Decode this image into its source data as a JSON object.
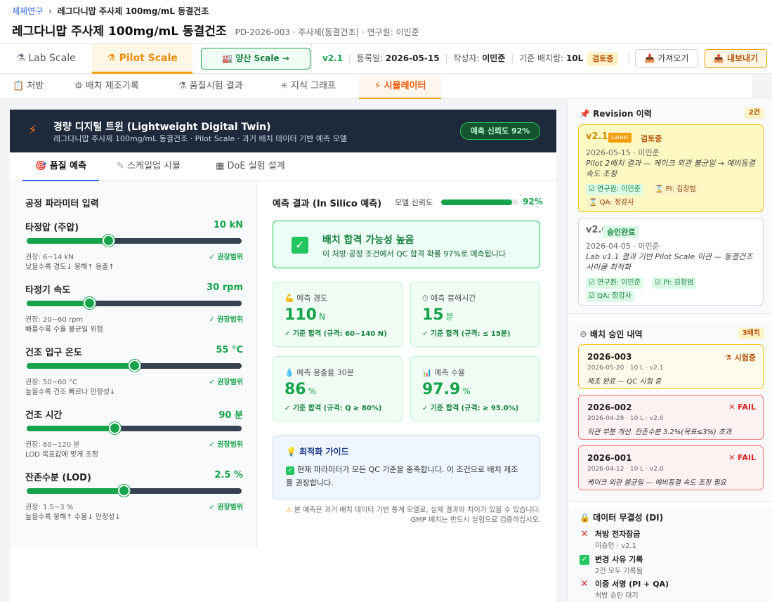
{
  "breadcrumb": {
    "root": "제제연구",
    "sep": "›",
    "current": "레그다니맙 주사제 100mg/mL 동결건조"
  },
  "header": {
    "title": "레그다니맙 주사제 100mg/mL 동결건조",
    "meta": "PD-2026-003 · 주사제(동결건조) · 연구원: 이민준"
  },
  "scale": {
    "lab": "Lab Scale",
    "pilot": "Pilot Scale",
    "mass": "양산 Scale →"
  },
  "info": {
    "version": "v2.1",
    "reg_label": "등록일:",
    "reg": "2026-05-15",
    "author_label": "작성자:",
    "author": "이민준",
    "batch_label": "기준 배치량:",
    "batch": "10L",
    "status": "검토중"
  },
  "actions": {
    "import": "가져오기",
    "export": "내보내기"
  },
  "tabs": [
    "처방",
    "배치 제조기록",
    "품질시험 결과",
    "지식 그래프",
    "시뮬레이터"
  ],
  "twin": {
    "title": "경량 디지털 트윈 (Lightweight Digital Twin)",
    "subtitle": "레그다니맙 주사제 100mg/mL 동결건조 · Pilot Scale · 과거 배치 데이터 기반 예측 모델",
    "confidence": "예측 신뢰도 92%"
  },
  "subtabs": [
    "품질 예측",
    "스케일업 시뮬",
    "DoE 실험 설계"
  ],
  "params": {
    "title": "공정 파라미터 입력",
    "ok": "✓ 권장범위",
    "items": [
      {
        "name": "타정압 (주압)",
        "value": "10 kN",
        "level": 0.38,
        "range": "권장: 6~14 kN",
        "note": "낮을수록 경도↓ 붕해↑ 용출↑"
      },
      {
        "name": "타정기 속도",
        "value": "30 rpm",
        "level": 0.29,
        "range": "권장: 20~60 rpm",
        "note": "빠를수록 수율 불균일 위험"
      },
      {
        "name": "건조 입구 온도",
        "value": "55 °C",
        "level": 0.5,
        "range": "권장: 50~60 °C",
        "note": "높을수록 건조 빠르나 안정성↓"
      },
      {
        "name": "건조 시간",
        "value": "90 분",
        "level": 0.41,
        "range": "권장: 60~120 분",
        "note": "LOD 목표값에 맞게 조정"
      },
      {
        "name": "잔존수분 (LOD)",
        "value": "2.5 %",
        "level": 0.45,
        "range": "권장: 1.5~3 %",
        "note": "높을수록 붕해↑ 수율↓ 안정성↓"
      }
    ]
  },
  "prediction": {
    "title": "예측 결과 (In Silico 예측)",
    "conf_label": "모델 신뢰도",
    "conf_value": "92%",
    "conf_level": 0.92,
    "pass_title": "배치 합격 가능성 높음",
    "pass_sub": "이 처방·공정 조건에서 QC 합격 확률 97%로 예측됩니다",
    "cards": [
      {
        "label": "예측 경도",
        "value": "110",
        "unit": "N",
        "spec": "✓ 기준 합격 (규격: 60~140 N)",
        "icon": "💪"
      },
      {
        "label": "예측 붕해시간",
        "value": "15",
        "unit": "분",
        "spec": "✓ 기준 합격 (규격: ≤ 15분)",
        "icon": "⏱"
      },
      {
        "label": "예측 용출율 30분",
        "value": "86",
        "unit": "%",
        "spec": "✓ 기준 합격 (규격: Q ≥ 80%)",
        "icon": "💧"
      },
      {
        "label": "예측 수율",
        "value": "97.9",
        "unit": "%",
        "spec": "✓ 기준 합격 (규격: ≥ 95.0%)",
        "icon": "📊"
      }
    ],
    "guide_title": "최적화 가이드",
    "guide_body": "현재 파라미터가 모든 QC 기준을 충족합니다. 이 조건으로 배치 제조를 권장합니다.",
    "disclaimer": "본 예측은 과거 배치 데이터 기반 통계 모델로, 실제 결과와 차이가 있을 수 있습니다. GMP 배치는 반드시 실험으로 검증하십시오."
  },
  "revision": {
    "title": "Revision 이력",
    "count": "2건",
    "items": [
      {
        "ver": "v2.1",
        "latest": "Latest",
        "status": "검토중",
        "date": "2026-05-15 · 이민준",
        "note": "Pilot 2배치 결과 — 케이크 외관 불균일 → 예비동결 속도 조정",
        "tags": [
          "연구원: 이민준",
          "PI: 김창범",
          "QA: 정감사"
        ]
      },
      {
        "ver": "v2.0",
        "status": "승인완료",
        "date": "2026-04-05 · 이민준",
        "note": "Lab v1.1 결과 기반 Pilot Scale 이관 — 동결건조 사이클 최적화",
        "tags": [
          "연구원: 이민준",
          "PI: 김창범",
          "QA: 정감사"
        ]
      }
    ]
  },
  "batches": {
    "title": "배치 승인 내역",
    "count": "3배치",
    "items": [
      {
        "id": "2026-003",
        "status": "시험중",
        "meta": "2026-05-20 · 10 L · v2.1",
        "note": "제조 완료 — QC 시험 중"
      },
      {
        "id": "2026-002",
        "status": "FAIL",
        "meta": "2026-04-28 · 10 L · v2.0",
        "note": "외관 부분 개선. 잔존수분 3.2%(목표≤3%) 초과"
      },
      {
        "id": "2026-001",
        "status": "FAIL",
        "meta": "2026-04-12 · 10 L · v2.0",
        "note": "케이크 외관 불균일 — 예비동결 속도 조정 필요"
      }
    ]
  },
  "integrity": {
    "title": "데이터 무결성 (DI)",
    "items": [
      {
        "name": "처방 전자잠금",
        "desc": "미승인 · v2.1",
        "ok": false
      },
      {
        "name": "변경 사유 기록",
        "desc": "2건 모두 기록됨",
        "ok": true
      },
      {
        "name": "이중 서명 (PI + QA)",
        "desc": "처방 승인 대기",
        "ok": false
      }
    ]
  }
}
